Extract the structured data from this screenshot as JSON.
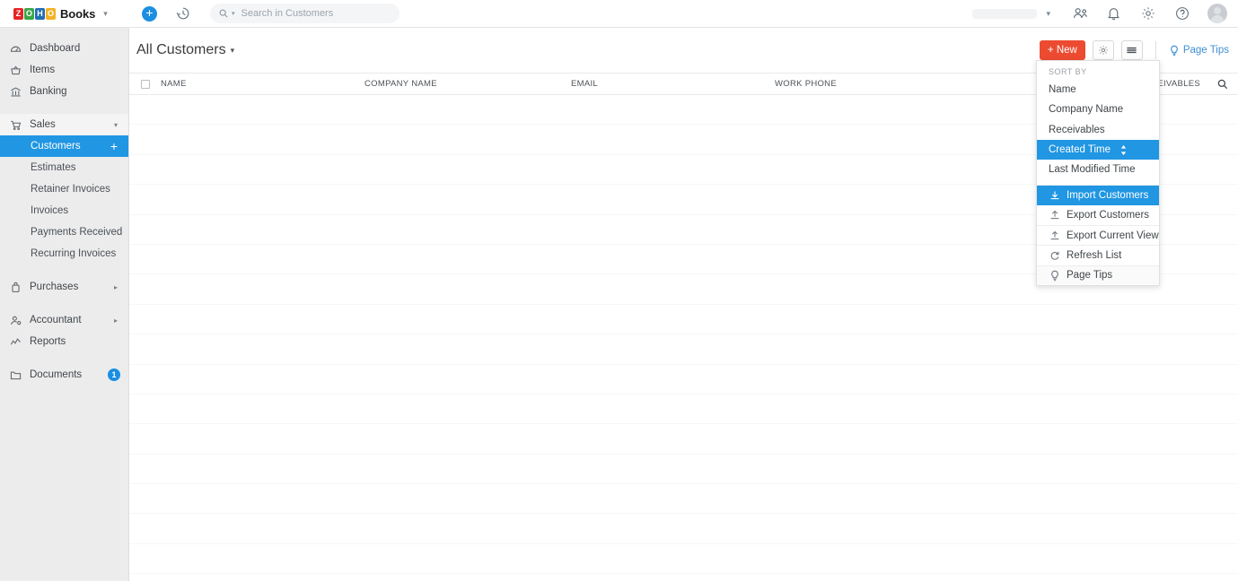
{
  "app": {
    "brand_tiles": [
      {
        "letter": "Z",
        "color": "#e42527"
      },
      {
        "letter": "O",
        "color": "#3aa648"
      },
      {
        "letter": "H",
        "color": "#226db4"
      },
      {
        "letter": "O",
        "color": "#f4b223"
      }
    ],
    "brand_name": "Books",
    "brand_caret": "⌄"
  },
  "topbar": {
    "add_icon": "plus-icon",
    "add_label": "+",
    "history_icon": "clock-history-icon",
    "search": {
      "placeholder": "Search in Customers",
      "value": "",
      "icon": "search-icon",
      "caret": "▾"
    },
    "org_caret": "⌄",
    "icons": [
      {
        "name": "users-icon"
      },
      {
        "name": "bell-icon"
      },
      {
        "name": "gear-icon"
      },
      {
        "name": "help-icon"
      }
    ],
    "avatar": "user-avatar"
  },
  "sidebar": {
    "items": [
      {
        "label": "Dashboard",
        "icon": "dashboard-icon",
        "type": "item"
      },
      {
        "label": "Items",
        "icon": "items-basket-icon",
        "type": "item"
      },
      {
        "label": "Banking",
        "icon": "bank-icon",
        "type": "item"
      },
      {
        "label": "Sales",
        "icon": "cart-icon",
        "type": "group",
        "arrow": "▾",
        "expanded": true
      },
      {
        "label": "Customers",
        "type": "sub",
        "active": true,
        "plus": "+"
      },
      {
        "label": "Estimates",
        "type": "sub"
      },
      {
        "label": "Retainer Invoices",
        "type": "sub"
      },
      {
        "label": "Invoices",
        "type": "sub"
      },
      {
        "label": "Payments Received",
        "type": "sub"
      },
      {
        "label": "Recurring Invoices",
        "type": "sub"
      },
      {
        "label": "Purchases",
        "icon": "bag-icon",
        "type": "group",
        "arrow": "▸"
      },
      {
        "label": "Accountant",
        "icon": "accountant-icon",
        "type": "group",
        "arrow": "▸"
      },
      {
        "label": "Reports",
        "icon": "reports-icon",
        "type": "item"
      },
      {
        "label": "Documents",
        "icon": "folder-icon",
        "type": "item",
        "badge": "1"
      }
    ]
  },
  "main": {
    "page_title": "All Customers",
    "title_caret": "▾",
    "new_button": "+ New",
    "settings_icon": "gear-icon",
    "list_view_icon": "hamburger-icon",
    "page_tips": "Page Tips",
    "page_tips_icon": "bulb-icon"
  },
  "table": {
    "select_all": "select-all-checkbox",
    "columns": [
      {
        "key": "name",
        "label": "NAME"
      },
      {
        "key": "company",
        "label": "COMPANY NAME"
      },
      {
        "key": "email",
        "label": "EMAIL"
      },
      {
        "key": "phone",
        "label": "WORK PHONE"
      },
      {
        "key": "receivables",
        "label": "RECEIVABLES"
      }
    ],
    "search_icon": "search-icon",
    "rows": [
      {},
      {},
      {},
      {},
      {},
      {},
      {},
      {},
      {},
      {},
      {},
      {},
      {},
      {},
      {},
      {}
    ]
  },
  "menu": {
    "sort_by_label": "SORT BY",
    "sort_options": [
      {
        "label": "Name",
        "selected": false
      },
      {
        "label": "Company Name",
        "selected": false
      },
      {
        "label": "Receivables",
        "selected": false
      },
      {
        "label": "Created Time",
        "selected": true,
        "sort_arrows": "↕"
      },
      {
        "label": "Last Modified Time",
        "selected": false
      }
    ],
    "actions": [
      {
        "label": "Import Customers",
        "icon": "import-icon",
        "selected": true
      },
      {
        "label": "Export Customers",
        "icon": "export-icon",
        "selected": false
      },
      {
        "label": "Export Current View",
        "icon": "export-icon",
        "selected": false,
        "separator": true
      },
      {
        "label": "Refresh List",
        "icon": "refresh-icon",
        "selected": false,
        "separator": true
      },
      {
        "label": "Page Tips",
        "icon": "bulb-icon",
        "selected": false,
        "separator": true,
        "tips": true
      }
    ]
  },
  "colors": {
    "accent_blue": "#2196e3",
    "new_button_red": "#ec4b31",
    "sidebar_bg": "#ececec",
    "link_blue": "#3f8fd4"
  }
}
